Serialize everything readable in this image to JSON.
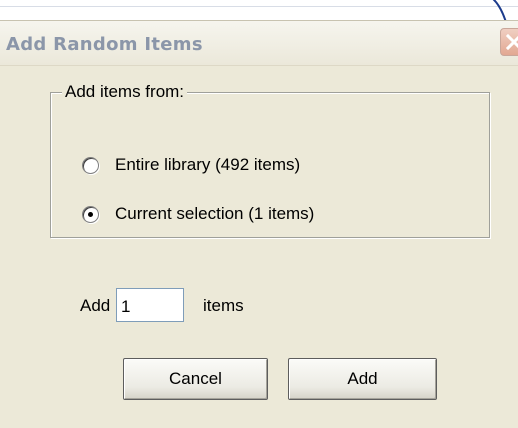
{
  "window": {
    "title": "Add Random Items",
    "close_icon": "close-icon",
    "accent_close": "#e2a892"
  },
  "source_group": {
    "label": "Add items from:",
    "options": [
      {
        "label": "Entire library (492 items)",
        "selected": false
      },
      {
        "label": "Current selection (1 items)",
        "selected": true
      }
    ]
  },
  "count_row": {
    "prefix": "Add",
    "value": "1",
    "suffix": "items"
  },
  "buttons": {
    "cancel_label": "Cancel",
    "add_label": "Add"
  },
  "colors": {
    "dialog_bg": "#ece9d8",
    "title_text": "#8b96a9"
  }
}
